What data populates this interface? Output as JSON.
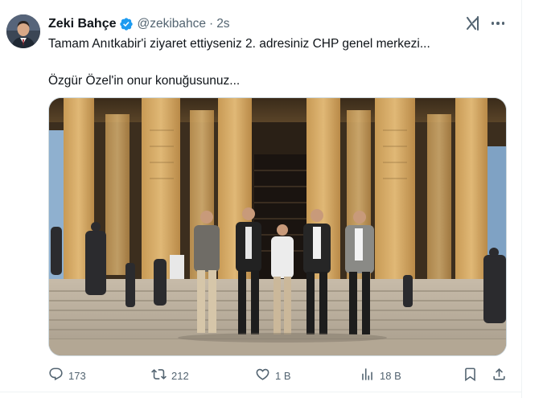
{
  "tweet": {
    "author_name": "Zeki Bahçe",
    "handle": "@zekibahce",
    "separator": "·",
    "time": "2s",
    "text_line1": "Tamam Anıtkabir'i ziyaret ettiyseniz 2. adresiniz CHP genel merkezi...",
    "text_line2": "Özgür Özel'in onur konuğusunuz...",
    "verified_color": "#1d9bf0"
  },
  "icons": {
    "verified": "verified-badge-icon",
    "grok": "grok-icon",
    "more": "more-horizontal-icon"
  },
  "actions": {
    "reply_count": "173",
    "repost_count": "212",
    "like_count": "1 B",
    "views_count": "18 B"
  },
  "colors": {
    "muted": "#536471",
    "text": "#0f1419",
    "border": "#cfd9de"
  }
}
